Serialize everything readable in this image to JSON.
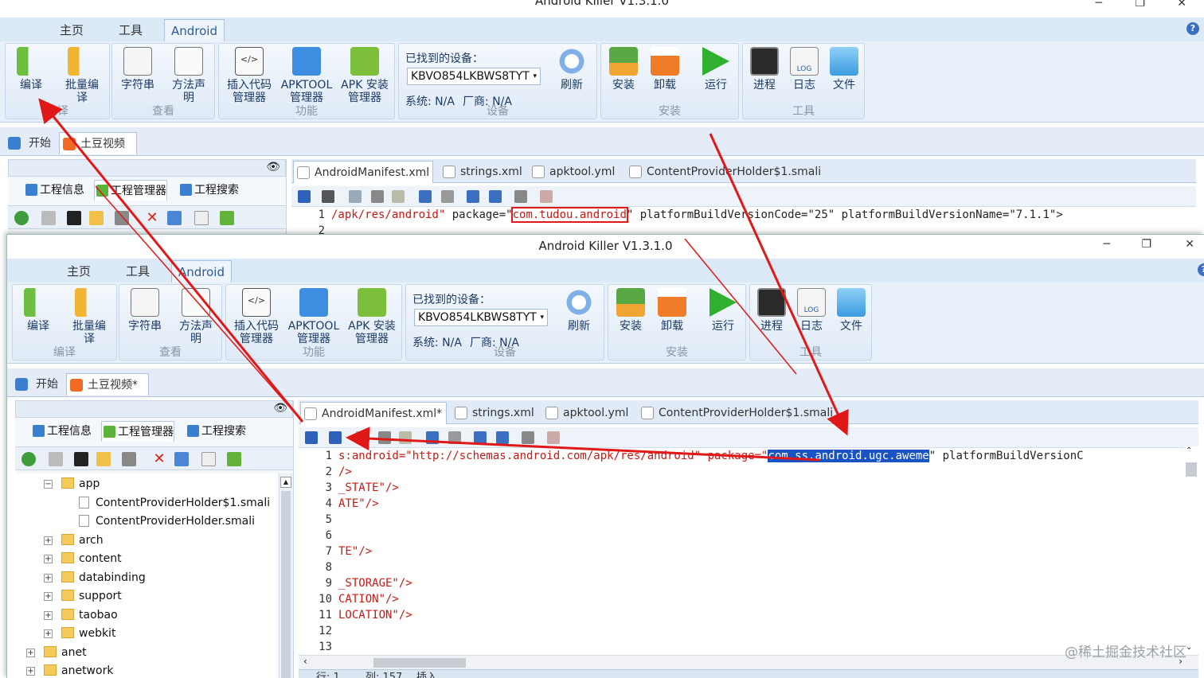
{
  "window": {
    "title": "Android Killer V1.3.1.0",
    "controls": {
      "minimize": "─",
      "restore": "❐",
      "close": "✕"
    }
  },
  "ribbon_tabs": [
    "主页",
    "工具",
    "Android"
  ],
  "help_label": "?",
  "ribbon": {
    "compile": {
      "build": "编译",
      "batch1": "批量编",
      "batch2": "译",
      "group": "编译"
    },
    "view": {
      "strings": "字符串",
      "method1": "方法声",
      "method2": "明",
      "group": "查看"
    },
    "function": {
      "insert1": "插入代码",
      "insert2": "管理器",
      "apktool1": "APKTOOL",
      "apktool2": "管理器",
      "apkinstall1": "APK 安装",
      "apkinstall2": "管理器",
      "group": "功能",
      "code_icon_text": "</>"
    },
    "device": {
      "found": "已找到的设备：",
      "selected": "KBVO854LKBWS8TYT",
      "system": "系统: N/A",
      "vendor": "厂商: N/A",
      "refresh": "刷新",
      "group": "设备"
    },
    "install": {
      "install": "安装",
      "uninstall": "卸载",
      "run": "运行",
      "group": "安装"
    },
    "tools": {
      "process": "进程",
      "log": "日志",
      "log_icon_text": "LOG",
      "file": "文件",
      "group": "工具"
    }
  },
  "top_window": {
    "doc_tabs": {
      "home": "开始",
      "project": "土豆视频"
    },
    "file_tabs": [
      "AndroidManifest.xml",
      "strings.xml",
      "apktool.yml",
      "ContentProviderHolder$1.smali"
    ],
    "panel_tabs": [
      "工程信息",
      "工程管理器",
      "工程搜索"
    ],
    "code": {
      "line1_num": "1",
      "line1_path": "/apk/res/android\"",
      "line1_pkg_attr": "package=\"",
      "line1_pkg": "com.tudou.android",
      "line1_rest": "\" platformBuildVersionCode=\"25\" platformBuildVersionName=\"7.1.1\">",
      "line2_num": "2"
    }
  },
  "bottom_window": {
    "doc_tabs": {
      "home": "开始",
      "project": "土豆视频*"
    },
    "file_tabs": [
      "AndroidManifest.xml*",
      "strings.xml",
      "apktool.yml",
      "ContentProviderHolder$1.smali"
    ],
    "panel_tabs": [
      "工程信息",
      "工程管理器",
      "工程搜索"
    ],
    "tree": [
      {
        "label": "app",
        "type": "folder",
        "depth": 2,
        "expanded": true
      },
      {
        "label": "ContentProviderHolder$1.smali",
        "type": "file",
        "depth": 3
      },
      {
        "label": "ContentProviderHolder.smali",
        "type": "file",
        "depth": 3
      },
      {
        "label": "arch",
        "type": "folder",
        "depth": 2
      },
      {
        "label": "content",
        "type": "folder",
        "depth": 2
      },
      {
        "label": "databinding",
        "type": "folder",
        "depth": 2
      },
      {
        "label": "support",
        "type": "folder",
        "depth": 2
      },
      {
        "label": "taobao",
        "type": "folder",
        "depth": 2
      },
      {
        "label": "webkit",
        "type": "folder",
        "depth": 2
      },
      {
        "label": "anet",
        "type": "folder",
        "depth": 1
      },
      {
        "label": "anetwork",
        "type": "folder",
        "depth": 1
      }
    ],
    "code_lines": [
      {
        "n": "1",
        "text": "s:android=\"http://schemas.android.com/apk/res/android\" package=\"",
        "sel": "com.ss.android.ugc.aweme",
        "tail": "\" platformBuildVersionC"
      },
      {
        "n": "2",
        "text": "/>"
      },
      {
        "n": "3",
        "text": "_STATE\"/>"
      },
      {
        "n": "4",
        "text": "ATE\"/>"
      },
      {
        "n": "5",
        "text": ""
      },
      {
        "n": "6",
        "text": ""
      },
      {
        "n": "7",
        "text": "TE\"/>"
      },
      {
        "n": "8",
        "text": ""
      },
      {
        "n": "9",
        "text": "_STORAGE\"/>"
      },
      {
        "n": "10",
        "text": "CATION\"/>"
      },
      {
        "n": "11",
        "text": "LOCATION\"/>"
      },
      {
        "n": "12",
        "text": ""
      },
      {
        "n": "13",
        "text": ""
      }
    ],
    "status": {
      "row": "行: 1",
      "col": "列: 157",
      "mode": "插入"
    }
  },
  "watermark": "@稀土掘金技术社区",
  "colors": {
    "accent": "#2e5a96",
    "selection": "#1a53c4",
    "arrow": "#e01818"
  }
}
